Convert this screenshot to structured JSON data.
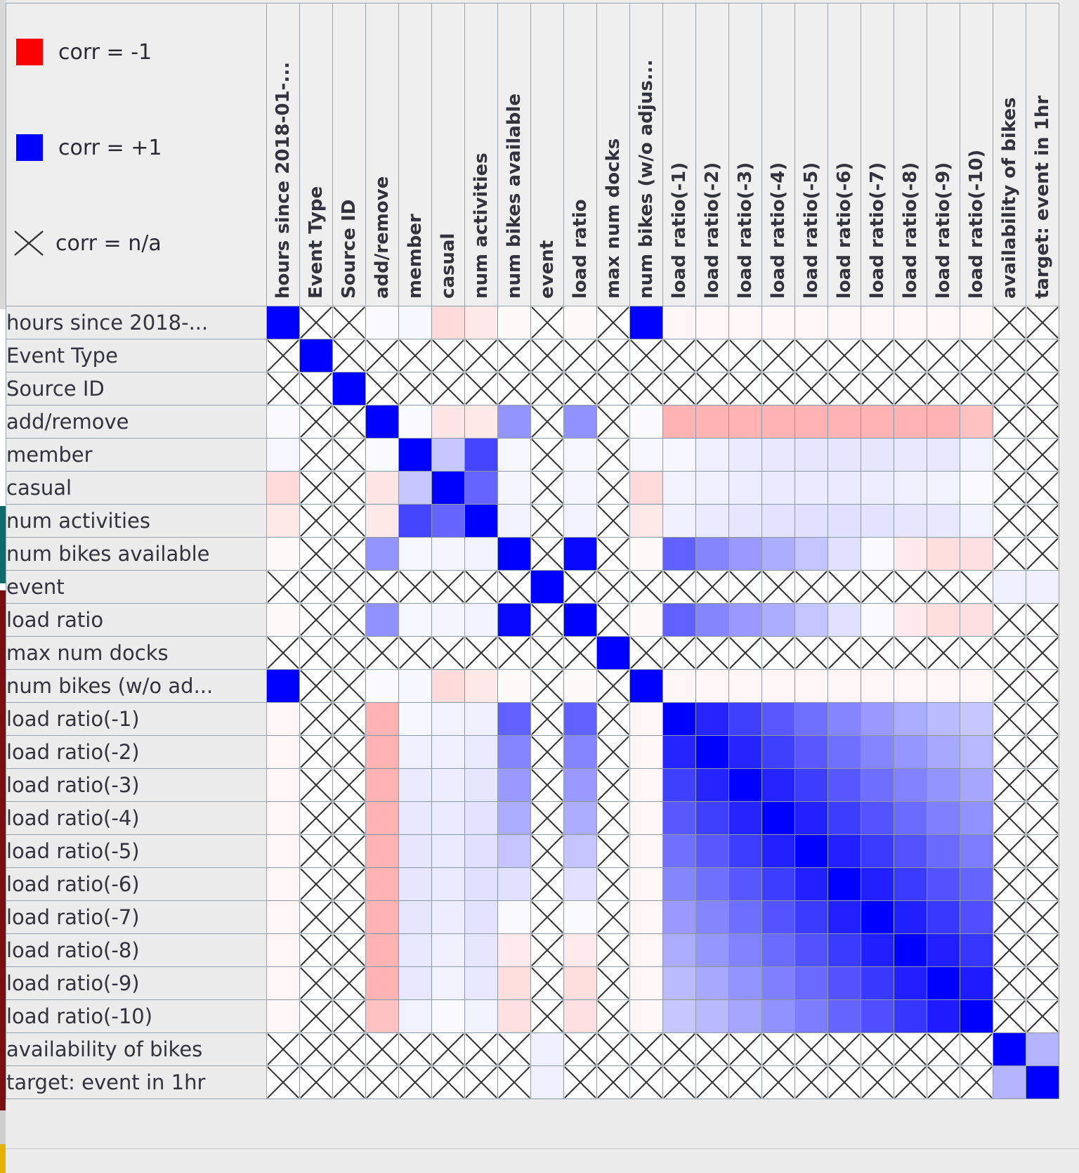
{
  "legend": {
    "items": [
      {
        "label": "corr = -1",
        "icon": "square-swatch",
        "color": "#ff0000"
      },
      {
        "label": "corr = +1",
        "icon": "square-swatch",
        "color": "#0000ff"
      },
      {
        "label": "corr = n/a",
        "icon": "cross-icon",
        "color": "#333333"
      }
    ]
  },
  "colors": {
    "negative": "#ff0000",
    "positive": "#0000ff",
    "na": "#333333",
    "grid_line": "#8d99a6",
    "header_bg": "#efefef"
  },
  "chart_data": {
    "type": "heatmap",
    "title": "",
    "xlabel": "",
    "ylabel": "",
    "zlim": [
      -1,
      1
    ],
    "legend_position": "top-left",
    "grid": true,
    "na_marker": "cross",
    "categories": [
      "hours since 2018-...",
      "Event Type",
      "Source ID",
      "add/remove",
      "member",
      "casual",
      "num activities",
      "num bikes available",
      "event",
      "load ratio",
      "max num docks",
      "num bikes (w/o ad...",
      "load ratio(-1)",
      "load ratio(-2)",
      "load ratio(-3)",
      "load ratio(-4)",
      "load ratio(-5)",
      "load ratio(-6)",
      "load ratio(-7)",
      "load ratio(-8)",
      "load ratio(-9)",
      "load ratio(-10)",
      "availability of bikes",
      "target: event in 1hr"
    ],
    "column_labels": [
      "hours since 2018-01-...",
      "Event Type",
      "Source ID",
      "add/remove",
      "member",
      "casual",
      "num activities",
      "num bikes available",
      "event",
      "load ratio",
      "max num docks",
      "num bikes (w/o adjus...",
      "load ratio(-1)",
      "load ratio(-2)",
      "load ratio(-3)",
      "load ratio(-4)",
      "load ratio(-5)",
      "load ratio(-6)",
      "load ratio(-7)",
      "load ratio(-8)",
      "load ratio(-9)",
      "load ratio(-10)",
      "availability of bikes",
      "target: event in 1hr"
    ],
    "row_labels": [
      "hours since 2018-...",
      "Event Type",
      "Source ID",
      "add/remove",
      "member",
      "casual",
      "num activities",
      "num bikes available",
      "event",
      "load ratio",
      "max num docks",
      "num bikes (w/o ad...",
      "load ratio(-1)",
      "load ratio(-2)",
      "load ratio(-3)",
      "load ratio(-4)",
      "load ratio(-5)",
      "load ratio(-6)",
      "load ratio(-7)",
      "load ratio(-8)",
      "load ratio(-9)",
      "load ratio(-10)",
      "availability of bikes",
      "target: event in 1hr"
    ],
    "values": [
      [
        1.0,
        null,
        null,
        0.02,
        0.03,
        -0.14,
        -0.09,
        -0.02,
        null,
        -0.02,
        null,
        1.0,
        -0.03,
        -0.03,
        -0.03,
        -0.03,
        -0.03,
        -0.03,
        -0.03,
        -0.03,
        -0.03,
        -0.03,
        null,
        null
      ],
      [
        null,
        1.0,
        null,
        null,
        null,
        null,
        null,
        null,
        null,
        null,
        null,
        null,
        null,
        null,
        null,
        null,
        null,
        null,
        null,
        null,
        null,
        null,
        null,
        null
      ],
      [
        null,
        null,
        1.0,
        null,
        null,
        null,
        null,
        null,
        null,
        null,
        null,
        null,
        null,
        null,
        null,
        null,
        null,
        null,
        null,
        null,
        null,
        null,
        null,
        null
      ],
      [
        0.02,
        null,
        null,
        1.0,
        0.02,
        -0.1,
        -0.09,
        0.42,
        null,
        0.43,
        null,
        0.02,
        -0.3,
        -0.3,
        -0.3,
        -0.3,
        -0.3,
        -0.3,
        -0.3,
        -0.3,
        -0.3,
        -0.24,
        null,
        null
      ],
      [
        0.03,
        null,
        null,
        0.02,
        1.0,
        0.22,
        0.73,
        0.03,
        null,
        0.03,
        null,
        0.03,
        0.03,
        0.06,
        0.08,
        0.09,
        0.1,
        0.1,
        0.1,
        0.09,
        0.09,
        0.05,
        null,
        null
      ],
      [
        -0.14,
        null,
        null,
        -0.1,
        0.22,
        1.0,
        0.6,
        0.04,
        null,
        0.04,
        null,
        -0.14,
        0.05,
        0.06,
        0.07,
        0.08,
        0.08,
        0.08,
        0.07,
        0.06,
        0.05,
        0.02,
        null,
        null
      ],
      [
        -0.09,
        null,
        null,
        -0.09,
        0.73,
        0.6,
        1.0,
        0.05,
        null,
        0.05,
        null,
        -0.09,
        0.06,
        0.08,
        0.1,
        0.11,
        0.12,
        0.12,
        0.11,
        0.1,
        0.09,
        0.05,
        null,
        null
      ],
      [
        -0.02,
        null,
        null,
        0.42,
        0.03,
        0.04,
        0.05,
        1.0,
        null,
        0.97,
        null,
        -0.02,
        0.62,
        0.48,
        0.4,
        0.32,
        0.23,
        0.12,
        0.02,
        -0.08,
        -0.13,
        -0.12,
        null,
        null
      ],
      [
        null,
        null,
        null,
        null,
        null,
        null,
        null,
        null,
        1.0,
        null,
        null,
        null,
        null,
        null,
        null,
        null,
        null,
        null,
        null,
        null,
        null,
        null,
        0.06,
        0.06
      ],
      [
        -0.02,
        null,
        null,
        0.43,
        0.03,
        0.04,
        0.05,
        0.97,
        null,
        1.0,
        null,
        -0.02,
        0.62,
        0.48,
        0.4,
        0.32,
        0.23,
        0.12,
        0.02,
        -0.08,
        -0.13,
        -0.12,
        null,
        null
      ],
      [
        null,
        null,
        null,
        null,
        null,
        null,
        null,
        null,
        null,
        null,
        1.0,
        null,
        null,
        null,
        null,
        null,
        null,
        null,
        null,
        null,
        null,
        null,
        null,
        null
      ],
      [
        1.0,
        null,
        null,
        0.02,
        0.03,
        -0.14,
        -0.09,
        -0.02,
        null,
        -0.02,
        null,
        1.0,
        -0.03,
        -0.03,
        -0.03,
        -0.03,
        -0.03,
        -0.03,
        -0.03,
        -0.03,
        -0.03,
        -0.03,
        null,
        null
      ],
      [
        -0.03,
        null,
        null,
        -0.3,
        0.03,
        0.05,
        0.06,
        0.62,
        null,
        0.62,
        null,
        -0.03,
        1.0,
        0.86,
        0.75,
        0.65,
        0.56,
        0.48,
        0.4,
        0.33,
        0.27,
        0.22,
        null,
        null
      ],
      [
        -0.03,
        null,
        null,
        -0.3,
        0.06,
        0.06,
        0.08,
        0.48,
        null,
        0.48,
        null,
        -0.03,
        0.86,
        1.0,
        0.86,
        0.75,
        0.65,
        0.56,
        0.48,
        0.41,
        0.34,
        0.28,
        null,
        null
      ],
      [
        -0.03,
        null,
        null,
        -0.3,
        0.08,
        0.07,
        0.1,
        0.4,
        null,
        0.4,
        null,
        -0.03,
        0.75,
        0.86,
        1.0,
        0.86,
        0.76,
        0.66,
        0.57,
        0.49,
        0.42,
        0.35,
        null,
        null
      ],
      [
        -0.03,
        null,
        null,
        -0.3,
        0.09,
        0.08,
        0.11,
        0.32,
        null,
        0.32,
        null,
        -0.03,
        0.65,
        0.75,
        0.86,
        1.0,
        0.87,
        0.76,
        0.67,
        0.58,
        0.5,
        0.43,
        null,
        null
      ],
      [
        -0.03,
        null,
        null,
        -0.3,
        0.1,
        0.08,
        0.12,
        0.23,
        null,
        0.23,
        null,
        -0.03,
        0.56,
        0.65,
        0.76,
        0.87,
        1.0,
        0.87,
        0.77,
        0.68,
        0.59,
        0.51,
        null,
        null
      ],
      [
        -0.03,
        null,
        null,
        -0.3,
        0.1,
        0.08,
        0.12,
        0.12,
        null,
        0.12,
        null,
        -0.03,
        0.48,
        0.56,
        0.66,
        0.76,
        0.87,
        1.0,
        0.87,
        0.77,
        0.68,
        0.6,
        null,
        null
      ],
      [
        -0.03,
        null,
        null,
        -0.3,
        0.1,
        0.07,
        0.11,
        0.02,
        null,
        0.02,
        null,
        -0.03,
        0.4,
        0.48,
        0.57,
        0.67,
        0.77,
        0.87,
        1.0,
        0.88,
        0.78,
        0.69,
        null,
        null
      ],
      [
        -0.03,
        null,
        null,
        -0.3,
        0.09,
        0.06,
        0.1,
        -0.08,
        null,
        -0.08,
        null,
        -0.03,
        0.33,
        0.41,
        0.49,
        0.58,
        0.68,
        0.77,
        0.88,
        1.0,
        0.88,
        0.79,
        null,
        null
      ],
      [
        -0.03,
        null,
        null,
        -0.3,
        0.09,
        0.05,
        0.09,
        -0.13,
        null,
        -0.13,
        null,
        -0.03,
        0.27,
        0.34,
        0.42,
        0.5,
        0.59,
        0.68,
        0.78,
        0.88,
        1.0,
        0.89,
        null,
        null
      ],
      [
        -0.03,
        null,
        null,
        -0.24,
        0.05,
        0.02,
        0.05,
        -0.12,
        null,
        -0.12,
        null,
        -0.03,
        0.22,
        0.28,
        0.35,
        0.43,
        0.51,
        0.6,
        0.69,
        0.79,
        0.89,
        1.0,
        null,
        null
      ],
      [
        null,
        null,
        null,
        null,
        null,
        null,
        null,
        null,
        0.06,
        null,
        null,
        null,
        null,
        null,
        null,
        null,
        null,
        null,
        null,
        null,
        null,
        null,
        1.0,
        0.3
      ],
      [
        null,
        null,
        null,
        null,
        null,
        null,
        null,
        null,
        0.06,
        null,
        null,
        null,
        null,
        null,
        null,
        null,
        null,
        null,
        null,
        null,
        null,
        null,
        0.3,
        1.0
      ]
    ]
  }
}
